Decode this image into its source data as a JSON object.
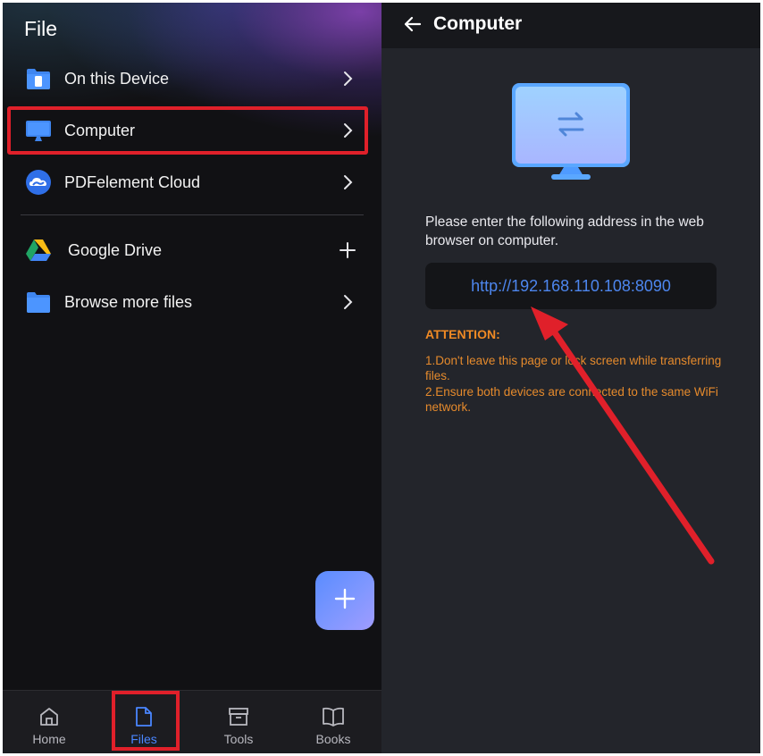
{
  "left": {
    "title": "File",
    "items": [
      {
        "label": "On this Device",
        "icon": "phone-folder-icon",
        "trail": "chevron-right-icon"
      },
      {
        "label": "Computer",
        "icon": "monitor-icon",
        "trail": "chevron-right-icon"
      },
      {
        "label": "PDFelement Cloud",
        "icon": "cloud-icon",
        "trail": "chevron-right-icon"
      },
      {
        "label": "Google Drive",
        "icon": "google-drive-icon",
        "trail": "plus-icon"
      },
      {
        "label": "Browse more files",
        "icon": "folder-icon",
        "trail": "chevron-right-icon"
      }
    ],
    "fab_icon": "plus-icon",
    "nav": [
      {
        "label": "Home",
        "icon": "home-icon"
      },
      {
        "label": "Files",
        "icon": "file-icon",
        "active": true
      },
      {
        "label": "Tools",
        "icon": "toolbox-icon"
      },
      {
        "label": "Books",
        "icon": "book-icon"
      }
    ]
  },
  "right": {
    "title": "Computer",
    "instruction": "Please enter the following address in the web browser on computer.",
    "address": "http://192.168.110.108:8090",
    "attention_title": "ATTENTION:",
    "attention_lines": [
      "1.Don't leave this page or lock screen while transferring files.",
      "2.Ensure both devices are connected to the same WiFi network."
    ]
  },
  "colors": {
    "accent_blue": "#4a86ff",
    "highlight_red": "#e0202a",
    "attention_orange": "#f08a24"
  }
}
